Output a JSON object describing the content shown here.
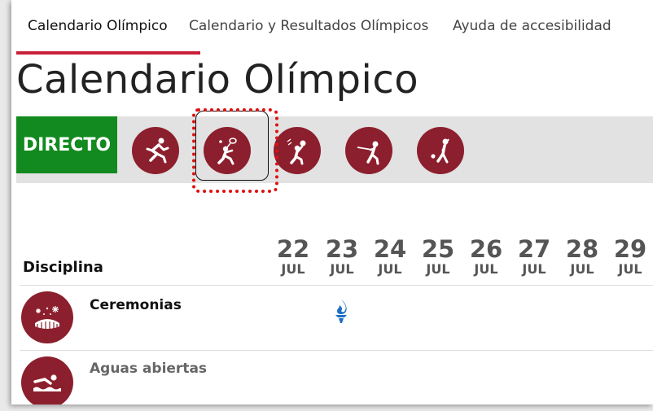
{
  "tabs": [
    {
      "label": "Calendario Olímpico",
      "active": true
    },
    {
      "label": "Calendario y Resultados Olímpicos",
      "active": false
    },
    {
      "label": "Ayuda de accesibilidad",
      "active": false
    }
  ],
  "page_title": "Calendario Olímpico",
  "sport_bar": {
    "live_label": "DIRECTO",
    "sports": [
      {
        "icon": "athletics-icon"
      },
      {
        "icon": "badminton-icon",
        "selected": true
      },
      {
        "icon": "handball-icon"
      },
      {
        "icon": "fencing-icon"
      },
      {
        "icon": "golf-icon"
      }
    ]
  },
  "schedule": {
    "column_header": "Disciplina",
    "days": [
      {
        "num": "22",
        "mon": "JUL"
      },
      {
        "num": "23",
        "mon": "JUL"
      },
      {
        "num": "24",
        "mon": "JUL"
      },
      {
        "num": "25",
        "mon": "JUL"
      },
      {
        "num": "26",
        "mon": "JUL"
      },
      {
        "num": "27",
        "mon": "JUL"
      },
      {
        "num": "28",
        "mon": "JUL"
      },
      {
        "num": "29",
        "mon": "JUL"
      }
    ],
    "rows": [
      {
        "name": "Ceremonias",
        "icon": "ceremony-stadium-icon",
        "event_icon": "olympic-flame-icon",
        "event_day": "23"
      },
      {
        "name": "Aguas abiertas",
        "icon": "swimming-icon"
      }
    ]
  },
  "colors": {
    "accent_red": "#c9203a",
    "sport_maroon": "#8c1f2d",
    "live_green": "#138a1f",
    "flame_blue": "#1c6fc4",
    "highlight_red": "#e01010"
  }
}
